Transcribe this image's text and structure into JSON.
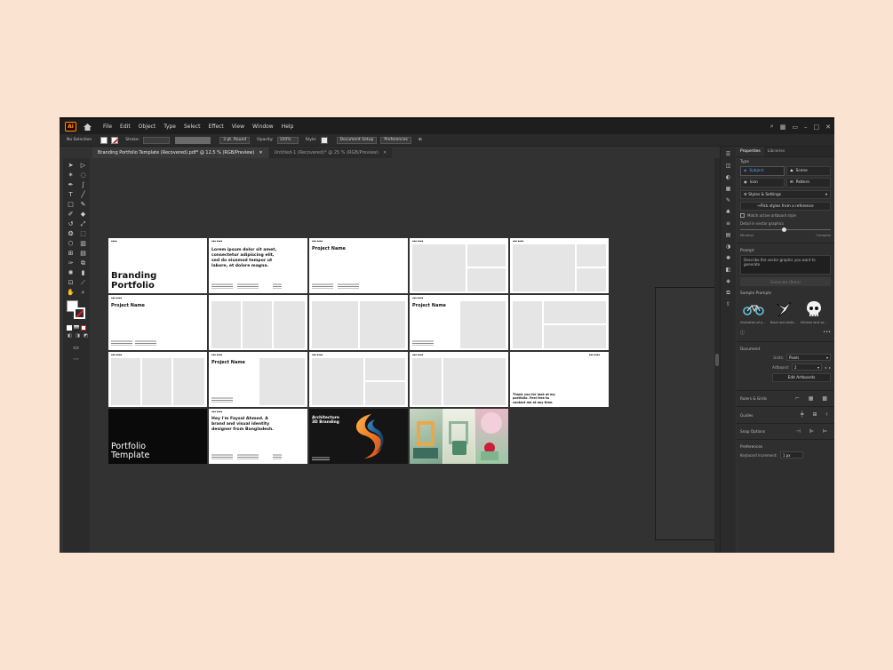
{
  "app": {
    "logo": "Ai",
    "menu": [
      "File",
      "Edit",
      "Object",
      "Type",
      "Select",
      "Effect",
      "View",
      "Window",
      "Help"
    ]
  },
  "controlbar": {
    "selection": "No Selection",
    "stroke_label": "Stroke:",
    "brush": "3 pt. Round",
    "opacity_label": "Opacity:",
    "opacity_value": "100%",
    "style_label": "Style:",
    "document_setup": "Document Setup",
    "preferences": "Preferences"
  },
  "tabs": [
    {
      "label": "Branding Portfolio Template (Recovered).pdf* @ 12.5 % (RGB/Preview)",
      "active": true
    },
    {
      "label": "Untitled-1 (Recovered)* @ 25 % (RGB/Preview)",
      "active": false
    }
  ],
  "artboards": {
    "cover_title": "Branding Portfolio",
    "lorem": "Lorem ipsum dolor sit amet, consectetur adipiscing elit, sed do eiusmod tempor ut labore, et dolore magna.",
    "project_name": "Project Name",
    "thanks": "Thank you for look at my portfolio. Feel free to contact me at any time.",
    "portfolio_template": "Portfolio Template",
    "about": "Hey I'm Faysal Ahmed. A brand and visual identity designer from Bangladesh.",
    "architecture": "Architecture 3D Branding"
  },
  "panel": {
    "tabs": [
      "Properties",
      "Libraries"
    ],
    "type_label": "Type",
    "subject": "Subject",
    "scene": "Scene",
    "icon": "Icon",
    "pattern": "Pattern",
    "styles_settings": "Styles & Settings",
    "pick_styles": "Pick styles from a reference",
    "match_active": "Match active artboard style",
    "detail_label": "Detail in vector graphics",
    "minimal": "Minimal",
    "complex": "Complex",
    "prompt_label": "Prompt",
    "prompt_placeholder": "Describe the vector graphic you want to generate",
    "generate": "Generate (Beta)",
    "sample_prompts": "Sample Prompts",
    "samples": [
      "Illustration of a...",
      "Black and white...",
      "Minimal skull ve..."
    ],
    "document_label": "Document",
    "units_label": "Units:",
    "units_value": "Pixels",
    "artboard_label": "Artboard:",
    "artboard_value": "2",
    "edit_artboards": "Edit Artboards",
    "rulers_grids": "Rulers & Grids",
    "guides": "Guides",
    "snap_options": "Snap Options",
    "preferences": "Preferences",
    "keyboard_increment": "Keyboard Increment:",
    "keyboard_value": "1 px"
  }
}
